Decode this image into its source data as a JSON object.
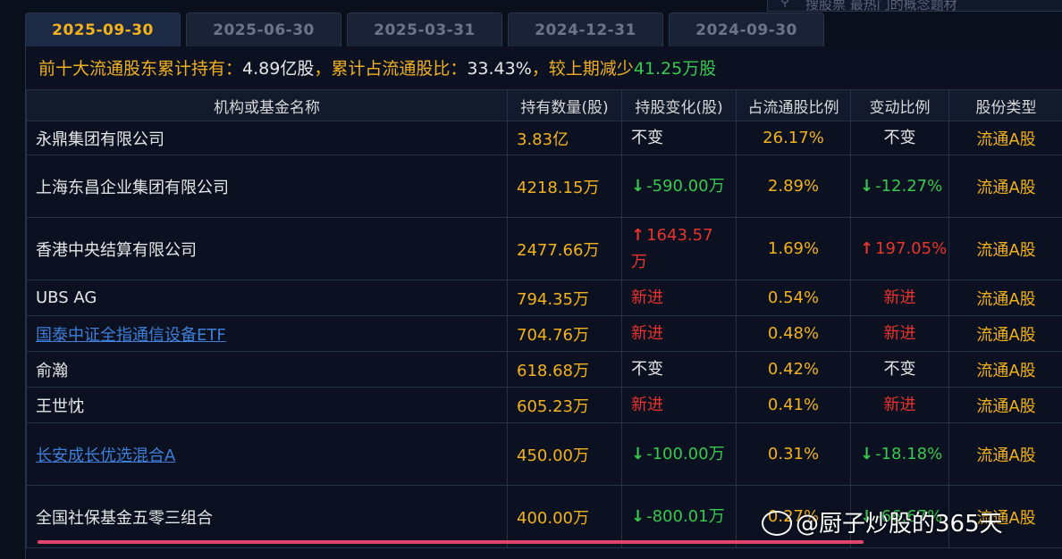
{
  "search": {
    "placeholder": "搜股票 最热门的概念题材"
  },
  "tabs": [
    "2025-09-30",
    "2025-06-30",
    "2025-03-31",
    "2024-12-31",
    "2024-09-30"
  ],
  "active_tab": 0,
  "summary": {
    "label1": "前十大流通股东累计持有：",
    "value1": "4.89亿股",
    "label2": "，累计占流通股比：",
    "value2": "33.43%",
    "label3": "，较上期减少",
    "value3": "41.25万股"
  },
  "table": {
    "headers": [
      "机构或基金名称",
      "持有数量(股)",
      "持股变化(股)",
      "占流通股比例",
      "变动比例",
      "股份类型"
    ],
    "rows": [
      {
        "name": "永鼎集团有限公司",
        "link": false,
        "shares": "3.83亿",
        "change": "不变",
        "change_dir": "same",
        "ratio": "26.17%",
        "chg_ratio": "不变",
        "chg_dir": "same",
        "type": "流通A股"
      },
      {
        "name": "上海东昌企业集团有限公司",
        "link": false,
        "shares": "4218.15万",
        "change": "-590.00万",
        "change_dir": "down",
        "ratio": "2.89%",
        "chg_ratio": "-12.27%",
        "chg_dir": "down",
        "type": "流通A股"
      },
      {
        "name": "香港中央结算有限公司",
        "link": false,
        "shares": "2477.66万",
        "change": "1643.57万",
        "change_dir": "up",
        "ratio": "1.69%",
        "chg_ratio": "197.05%",
        "chg_dir": "up",
        "type": "流通A股"
      },
      {
        "name": "UBS AG",
        "link": false,
        "shares": "794.35万",
        "change": "新进",
        "change_dir": "new",
        "ratio": "0.54%",
        "chg_ratio": "新进",
        "chg_dir": "new",
        "type": "流通A股"
      },
      {
        "name": "国泰中证全指通信设备ETF",
        "link": true,
        "shares": "704.76万",
        "change": "新进",
        "change_dir": "new",
        "ratio": "0.48%",
        "chg_ratio": "新进",
        "chg_dir": "new",
        "type": "流通A股"
      },
      {
        "name": "俞瀚",
        "link": false,
        "shares": "618.68万",
        "change": "不变",
        "change_dir": "same",
        "ratio": "0.42%",
        "chg_ratio": "不变",
        "chg_dir": "same",
        "type": "流通A股"
      },
      {
        "name": "王世忱",
        "link": false,
        "shares": "605.23万",
        "change": "新进",
        "change_dir": "new",
        "ratio": "0.41%",
        "chg_ratio": "新进",
        "chg_dir": "new",
        "type": "流通A股"
      },
      {
        "name": "长安成长优选混合A",
        "link": true,
        "shares": "450.00万",
        "change": "-100.00万",
        "change_dir": "down",
        "ratio": "0.31%",
        "chg_ratio": "-18.18%",
        "chg_dir": "down",
        "type": "流通A股"
      },
      {
        "name": "全国社保基金五零三组合",
        "link": false,
        "shares": "400.00万",
        "change": "-800.01万",
        "change_dir": "down",
        "ratio": "0.27%",
        "chg_ratio": "-66.67%",
        "chg_dir": "down",
        "type": "流通A股"
      }
    ]
  },
  "watermark": "@厨子炒股的365天",
  "colors": {
    "accent": "#f3b21b",
    "up": "#e8342c",
    "down": "#38c84e",
    "link": "#3d7fd9"
  }
}
